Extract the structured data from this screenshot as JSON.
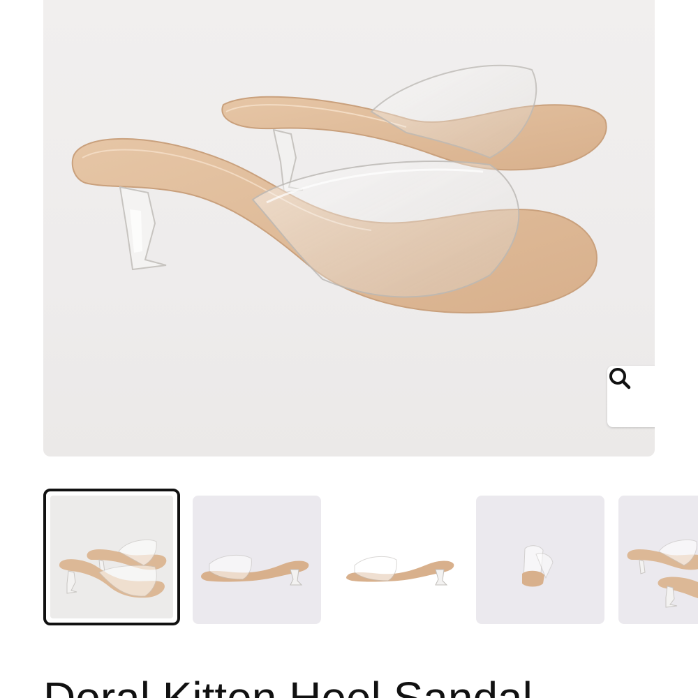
{
  "product": {
    "title": "Doral Kitten Heel Sandal"
  },
  "gallery": {
    "main_image": "clear-strap-kitten-heel-sandals-pair",
    "zoom_icon": "search-icon",
    "thumbnails": [
      {
        "image": "pair-angled-view",
        "selected": true
      },
      {
        "image": "single-side-view-grey-bg",
        "selected": false
      },
      {
        "image": "single-side-view-white-bg",
        "selected": false
      },
      {
        "image": "single-back-view",
        "selected": false
      },
      {
        "image": "pair-angled-view-cropped",
        "selected": false
      }
    ]
  },
  "colors": {
    "insole": "#ddb896",
    "strap": "#e8e6e2",
    "background": "#efedec",
    "selected_border": "#111111"
  }
}
